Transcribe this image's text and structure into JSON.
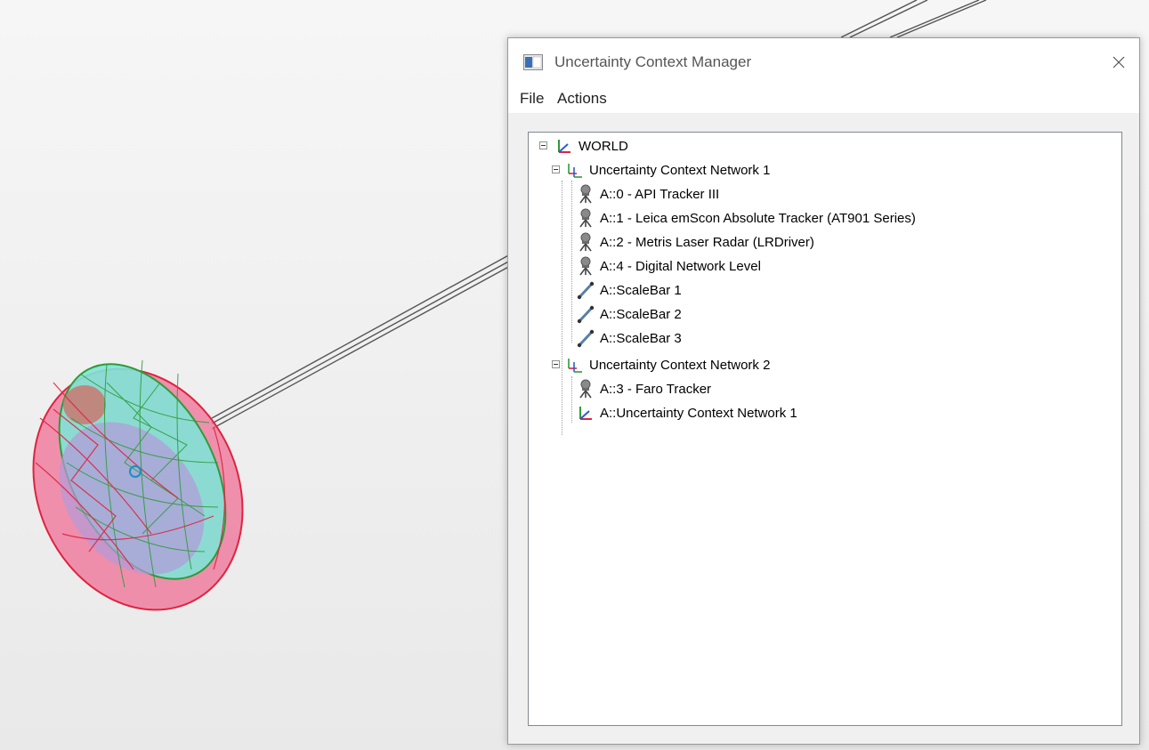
{
  "window": {
    "title": "Uncertainty Context Manager",
    "close_glyph": "✕"
  },
  "menu": {
    "file": "File",
    "actions": "Actions"
  },
  "tree": {
    "root": {
      "label": "WORLD",
      "icon": "world-frame-icon"
    },
    "networks": [
      {
        "label": "Uncertainty Context Network 1",
        "icon": "network-frame-icon",
        "children": [
          {
            "label": "A::0 - API Tracker III",
            "icon": "tracker-instrument-icon"
          },
          {
            "label": "A::1 - Leica emScon Absolute Tracker (AT901 Series)",
            "icon": "tracker-instrument-icon"
          },
          {
            "label": "A::2 - Metris Laser Radar (LRDriver)",
            "icon": "tracker-instrument-icon"
          },
          {
            "label": "A::4 - Digital Network Level",
            "icon": "tracker-instrument-icon"
          },
          {
            "label": "A::ScaleBar 1",
            "icon": "scalebar-icon"
          },
          {
            "label": "A::ScaleBar 2",
            "icon": "scalebar-icon"
          },
          {
            "label": "A::ScaleBar 3",
            "icon": "scalebar-icon"
          }
        ]
      },
      {
        "label": "Uncertainty Context Network 2",
        "icon": "network-frame-icon",
        "children": [
          {
            "label": "A::3 - Faro Tracker",
            "icon": "tracker-instrument-icon"
          },
          {
            "label": "A::Uncertainty Context Network 1",
            "icon": "world-frame-icon"
          }
        ]
      }
    ]
  },
  "colors": {
    "green_mesh": "#2e9b3a",
    "cyan_fill": "#7fe3d6",
    "red_mesh": "#e0233f",
    "pink_fill": "#ef6f95",
    "purple_fill": "#b39ad8"
  }
}
